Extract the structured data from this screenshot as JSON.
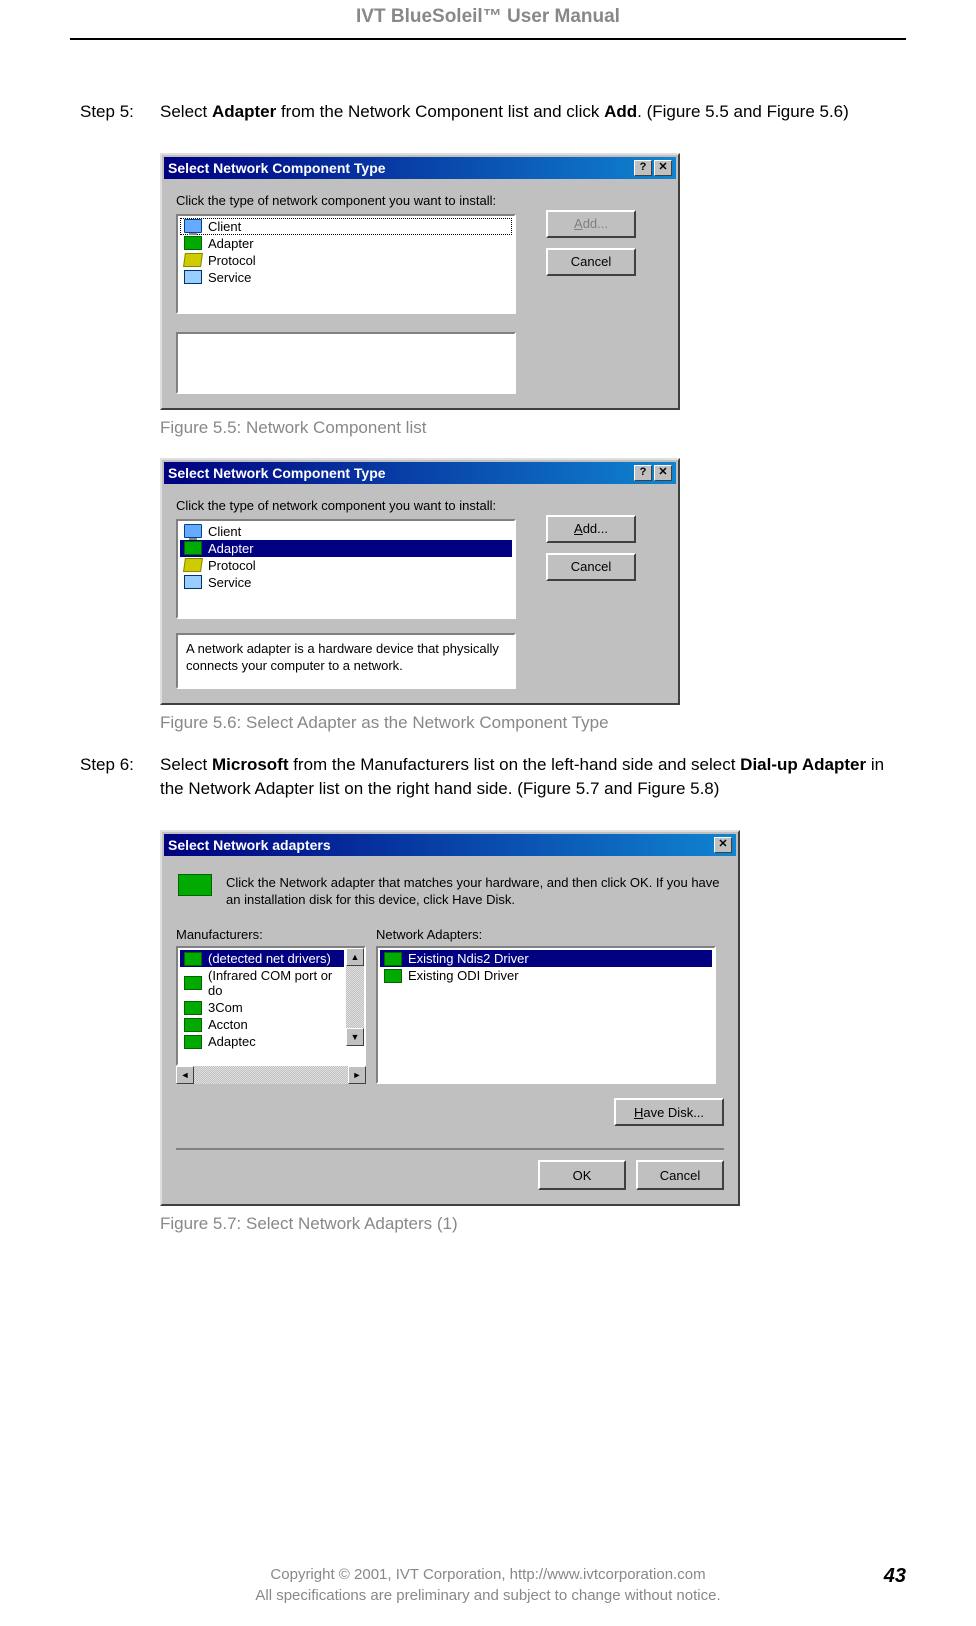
{
  "header": {
    "title": "IVT BlueSoleil™ User Manual"
  },
  "step5": {
    "label": "Step 5:",
    "text_pre": "Select ",
    "bold1": "Adapter",
    "text_mid": " from the Network Component list and click ",
    "bold2": "Add",
    "text_after": ". (Figure 5.5 and Figure 5.6)"
  },
  "dlg55": {
    "title": "Select Network Component Type",
    "instruction": "Click the type of network component you want to install:",
    "items": [
      "Client",
      "Adapter",
      "Protocol",
      "Service"
    ],
    "selected_index": 0,
    "add_label": "Add...",
    "cancel_label": "Cancel"
  },
  "fig55_caption": "Figure 5.5: Network Component list",
  "dlg56": {
    "title": "Select Network Component Type",
    "instruction": "Click the type of network component you want to install:",
    "items": [
      "Client",
      "Adapter",
      "Protocol",
      "Service"
    ],
    "selected_index": 1,
    "add_label": "Add...",
    "cancel_label": "Cancel",
    "desc": "A network adapter is a hardware device that physically connects your computer to a network."
  },
  "fig56_caption": "Figure 5.6: Select Adapter as the Network Component Type",
  "step6": {
    "label": "Step 6:",
    "text_pre": "Select ",
    "bold1": "Microsoft",
    "text_mid": " from the Manufacturers list on the left-hand side and select ",
    "bold2": "Dial-up Adapter",
    "text_after": " in the Network Adapter list on the right hand side. (Figure 5.7 and Figure 5.8)"
  },
  "dlg57": {
    "title": "Select Network adapters",
    "intro": "Click the Network adapter that matches your hardware, and then click OK. If you have an installation disk for this device, click Have Disk.",
    "mfr_label": "Manufacturers:",
    "mfr_items": [
      "(detected net drivers)",
      "(Infrared COM port or do",
      "3Com",
      "Accton",
      "Adaptec"
    ],
    "mfr_selected_index": 0,
    "adp_label": "Network Adapters:",
    "adp_items": [
      "Existing Ndis2 Driver",
      "Existing ODI Driver"
    ],
    "adp_selected_index": 0,
    "have_disk_label": "Have Disk...",
    "ok_label": "OK",
    "cancel_label": "Cancel"
  },
  "fig57_caption": "Figure 5.7: Select Network Adapters (1)",
  "footer": {
    "line1": "Copyright © 2001, IVT Corporation, http://www.ivtcorporation.com",
    "line2": "All specifications are preliminary and subject to change without notice.",
    "page": "43"
  }
}
